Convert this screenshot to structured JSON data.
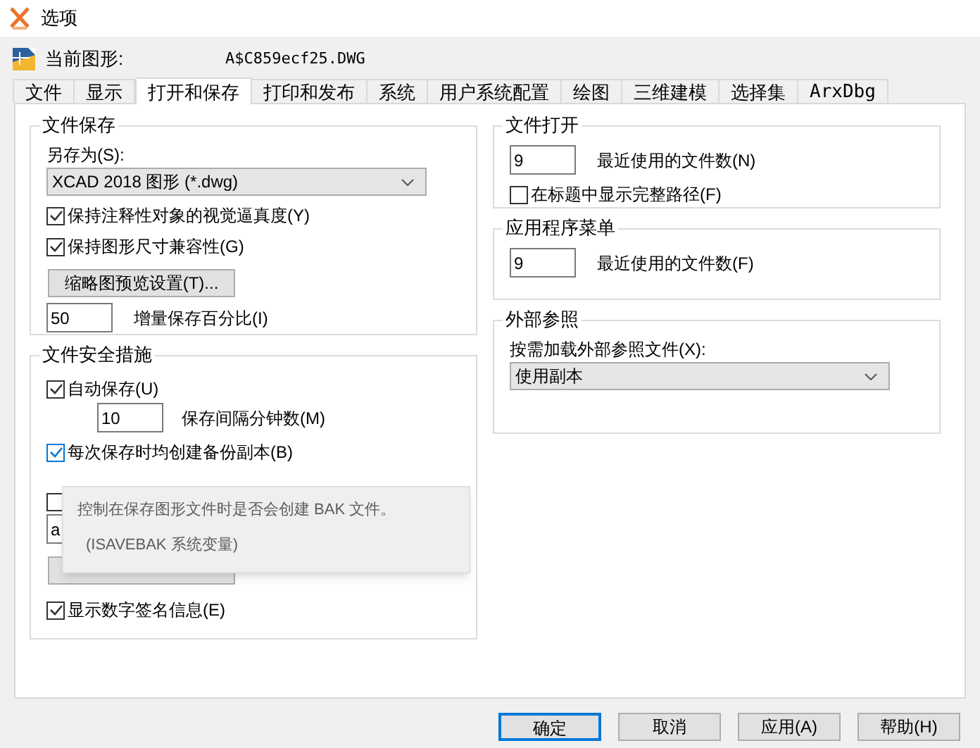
{
  "window": {
    "title": "选项"
  },
  "current_drawing": {
    "label": "当前图形:",
    "value": "A$C859ecf25.DWG"
  },
  "tabs": [
    {
      "label": "文件",
      "selected": false
    },
    {
      "label": "显示",
      "selected": false
    },
    {
      "label": "打开和保存",
      "selected": true
    },
    {
      "label": "打印和发布",
      "selected": false
    },
    {
      "label": "系统",
      "selected": false
    },
    {
      "label": "用户系统配置",
      "selected": false
    },
    {
      "label": "绘图",
      "selected": false
    },
    {
      "label": "三维建模",
      "selected": false
    },
    {
      "label": "选择集",
      "selected": false
    },
    {
      "label": "ArxDbg",
      "selected": false
    }
  ],
  "left_groups": [
    {
      "title": "文件保存",
      "items": [
        {
          "kind": "label",
          "text": "另存为(S):"
        },
        {
          "kind": "select",
          "value": "XCAD 2018 图形 (*.dwg)"
        },
        {
          "kind": "checkbox",
          "label": "保持注释性对象的视觉逼真度(Y)",
          "checked": true,
          "hovered": false
        },
        {
          "kind": "checkbox",
          "label": "保持图形尺寸兼容性(G)",
          "checked": true,
          "hovered": false
        },
        {
          "kind": "button",
          "label": "缩略图预览设置(T)..."
        },
        {
          "kind": "field",
          "value": "50",
          "caption": "增量保存百分比(I)"
        }
      ]
    },
    {
      "title": "文件安全措施",
      "items": [
        {
          "kind": "checkbox",
          "label": "自动保存(U)",
          "checked": true,
          "hovered": false
        },
        {
          "kind": "field_indented",
          "value": "10",
          "caption": "保存间隔分钟数(M)"
        },
        {
          "kind": "checkbox",
          "label": "每次保存时均创建备份副本(B)",
          "checked": true,
          "hovered": true
        },
        {
          "kind": "checkbox",
          "checked": false,
          "hovered": false
        },
        {
          "kind": "field",
          "value": "a"
        },
        {
          "kind": "button"
        },
        {
          "kind": "checkbox",
          "label": "显示数字签名信息(E)",
          "checked": true,
          "hovered": false
        }
      ],
      "tooltip": {
        "lines": [
          "控制在保存图形文件时是否会创建 BAK 文件。",
          "(ISAVEBAK 系统变量)"
        ]
      }
    }
  ],
  "right_groups": [
    {
      "title": "文件打开",
      "items": [
        {
          "kind": "field",
          "value": "9",
          "caption": "最近使用的文件数(N)"
        },
        {
          "kind": "checkbox",
          "label": "在标题中显示完整路径(F)",
          "checked": false,
          "hovered": false
        }
      ]
    },
    {
      "title": "应用程序菜单",
      "items": [
        {
          "kind": "field",
          "value": "9",
          "caption": "最近使用的文件数(F)"
        }
      ]
    },
    {
      "title": "外部参照",
      "items": [
        {
          "kind": "label",
          "text": "按需加载外部参照文件(X):"
        },
        {
          "kind": "select",
          "value": "使用副本"
        }
      ]
    }
  ],
  "buttons": [
    {
      "label": "确定",
      "default": true
    },
    {
      "label": "取消",
      "default": false
    },
    {
      "label": "应用(A)",
      "default": false
    },
    {
      "label": "帮助(H)",
      "default": false
    }
  ]
}
